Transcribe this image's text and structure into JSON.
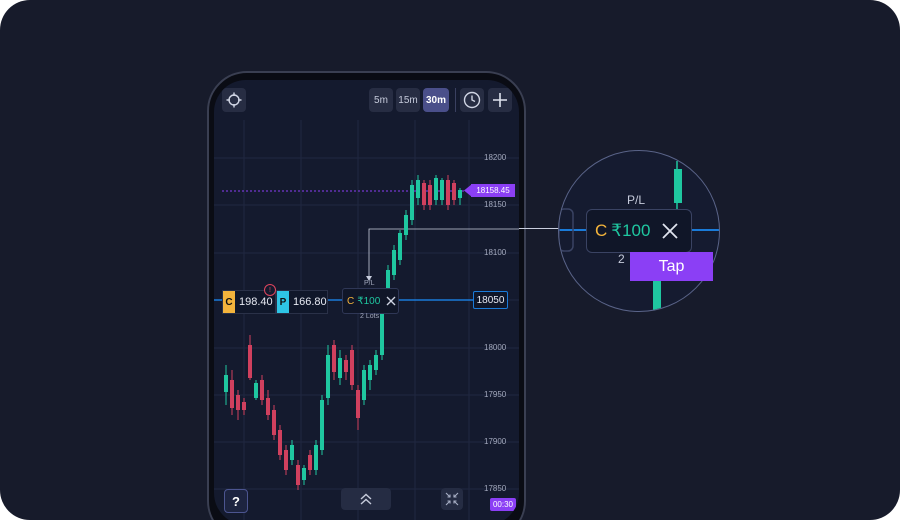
{
  "toolbar": {
    "timeframes": [
      "5m",
      "15m",
      "30m"
    ],
    "active_timeframe": "30m",
    "icons": [
      "crosshair-icon",
      "clock-icon",
      "plus-icon"
    ]
  },
  "price_axis": {
    "labels": [
      "18200",
      "18150",
      "18100",
      "18000",
      "17950",
      "17900",
      "17850"
    ]
  },
  "current_price": "18158.45",
  "strike_line": "18050",
  "call_box": {
    "tag": "C",
    "value": "198.40"
  },
  "put_box": {
    "tag": "P",
    "value": "166.80"
  },
  "warning_icon": "!",
  "position": {
    "pl_label": "P/L",
    "type": "C",
    "amount": "₹100",
    "lots": "2 Lots"
  },
  "bottom_bar": {
    "help_label": "?",
    "expand_icon": "chevron-up-double-icon",
    "collapse_icon": "arrows-inward-icon",
    "time": "00:30"
  },
  "zoom": {
    "pl_label": "P/L",
    "type": "C",
    "amount": "₹100",
    "lots_partial": "2",
    "tap_label": "Tap"
  },
  "colors": {
    "background": "#171b2b",
    "screen": "#141a2e",
    "bull": "#1fc7a0",
    "bear": "#d0405e",
    "accent": "#8b3ff5",
    "line_blue": "#1a7bd9",
    "call_tag": "#f4b43c",
    "put_tag": "#2ec5e6"
  }
}
